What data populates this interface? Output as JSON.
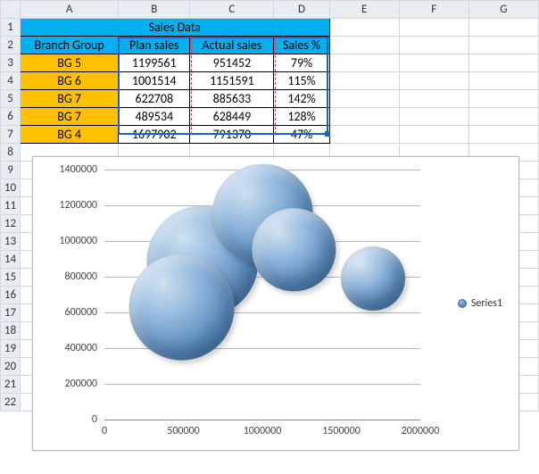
{
  "columns": [
    "A",
    "B",
    "C",
    "D",
    "E",
    "F",
    "G"
  ],
  "row_count": 22,
  "table": {
    "title": "Sales Data",
    "headers": {
      "a": "Branch Group",
      "b": "Plan sales",
      "c": "Actual sales",
      "d": "Sales %"
    },
    "rows": [
      {
        "bg": "BG 5",
        "plan": "1199561",
        "actual": "951452",
        "pct": "79%"
      },
      {
        "bg": "BG 6",
        "plan": "1001514",
        "actual": "1151591",
        "pct": "115%"
      },
      {
        "bg": "BG 7",
        "plan": "622708",
        "actual": "885633",
        "pct": "142%"
      },
      {
        "bg": "BG 7",
        "plan": "489534",
        "actual": "628449",
        "pct": "128%"
      },
      {
        "bg": "BG 4",
        "plan": "1697902",
        "actual": "791370",
        "pct": "47%"
      }
    ]
  },
  "chart_data": {
    "type": "bubble",
    "title": "",
    "xlabel": "",
    "ylabel": "",
    "xlim": [
      0,
      2000000
    ],
    "ylim": [
      0,
      1400000
    ],
    "x_ticks": [
      0,
      500000,
      1000000,
      1500000,
      2000000
    ],
    "y_ticks": [
      0,
      200000,
      400000,
      600000,
      800000,
      1000000,
      1200000,
      1400000
    ],
    "series": [
      {
        "name": "Series1",
        "points": [
          {
            "x": 1199561,
            "y": 951452,
            "size": 79
          },
          {
            "x": 1001514,
            "y": 1151591,
            "size": 115
          },
          {
            "x": 622708,
            "y": 885633,
            "size": 142
          },
          {
            "x": 489534,
            "y": 628449,
            "size": 128
          },
          {
            "x": 1697902,
            "y": 791370,
            "size": 47
          }
        ]
      }
    ]
  }
}
